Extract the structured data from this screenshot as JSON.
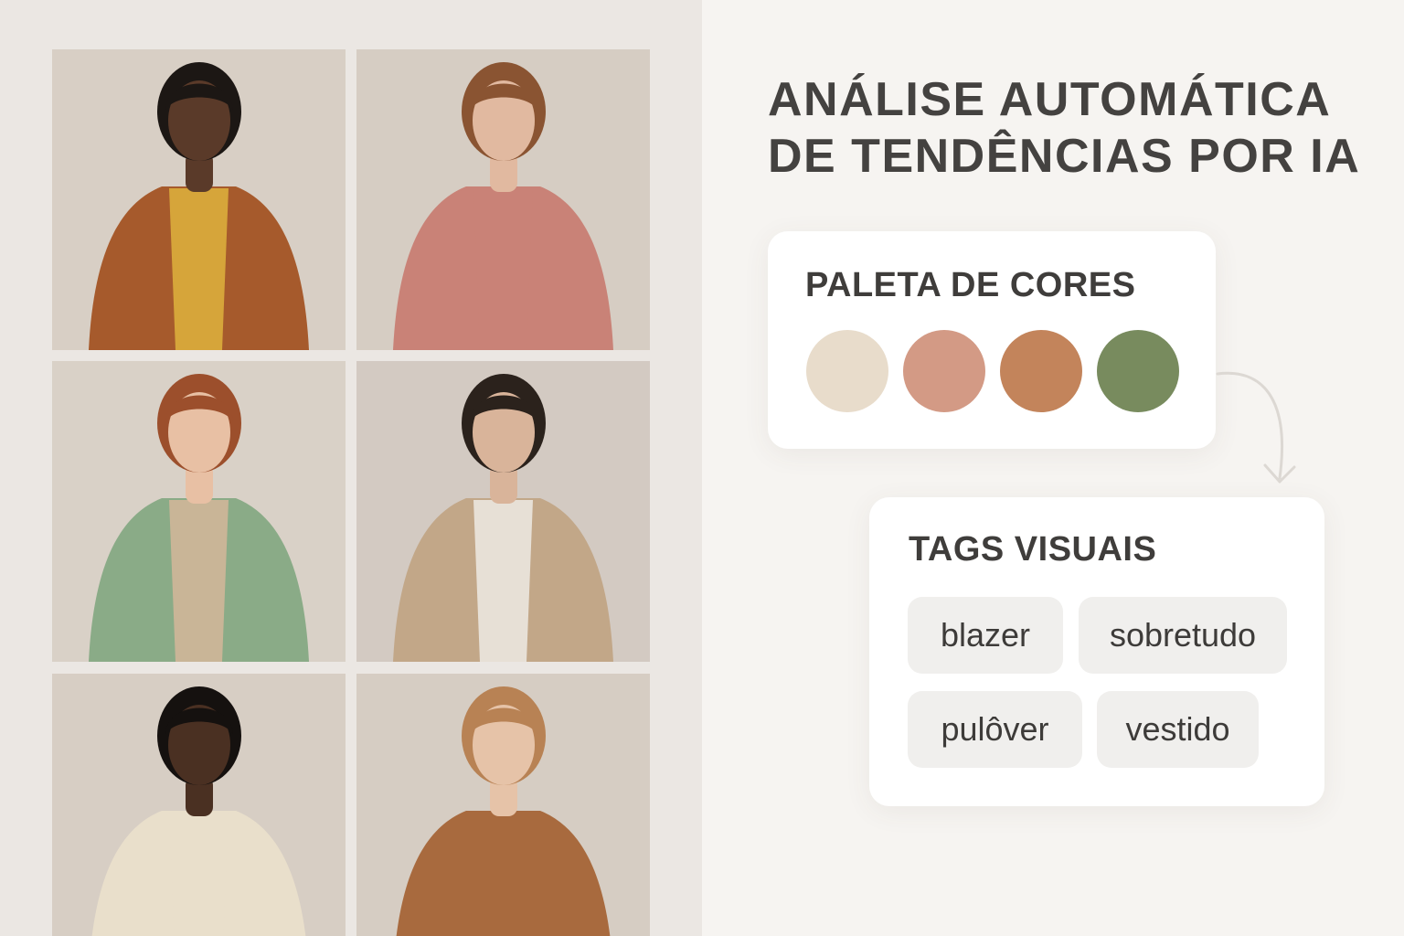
{
  "header": {
    "title_line1": "ANÁLISE AUTOMÁTICA",
    "title_line2": "DE TENDÊNCIAS POR IA"
  },
  "palette": {
    "title": "PALETA DE CORES",
    "colors": [
      "#e8dccb",
      "#d39a85",
      "#c3845b",
      "#788b5e"
    ]
  },
  "tags": {
    "title": "TAGS VISUAIS",
    "items": [
      "blazer",
      "sobretudo",
      "pulôver",
      "vestido"
    ]
  },
  "gallery": {
    "photos": [
      {
        "bg": "#d8cfc5",
        "skin": "#5a3a29",
        "hair": "#1c1714",
        "garment": "#a65a2c",
        "inner": "#d6a53a",
        "icon": "person-blazer-icon"
      },
      {
        "bg": "#d6cdc3",
        "skin": "#e1b9a0",
        "hair": "#8a5432",
        "garment": "#c98277",
        "inner": "#c98277",
        "icon": "person-wrap-dress-icon"
      },
      {
        "bg": "#d9d1c7",
        "skin": "#e8c0a4",
        "hair": "#9c4f2c",
        "garment": "#8aab87",
        "inner": "#c9b597",
        "icon": "person-pullover-icon"
      },
      {
        "bg": "#d3cac2",
        "skin": "#d9b49a",
        "hair": "#2b221c",
        "garment": "#c2a788",
        "inner": "#e7e0d6",
        "icon": "person-trench-coat-icon"
      },
      {
        "bg": "#d7cec4",
        "skin": "#4a3022",
        "hair": "#15110f",
        "garment": "#e9dfcb",
        "inner": "#e9dfcb",
        "icon": "person-cable-knit-icon"
      },
      {
        "bg": "#d6cdc3",
        "skin": "#e6c3a8",
        "hair": "#b88254",
        "garment": "#a86a3e",
        "inner": "#a86a3e",
        "icon": "person-knit-dress-icon"
      }
    ]
  }
}
